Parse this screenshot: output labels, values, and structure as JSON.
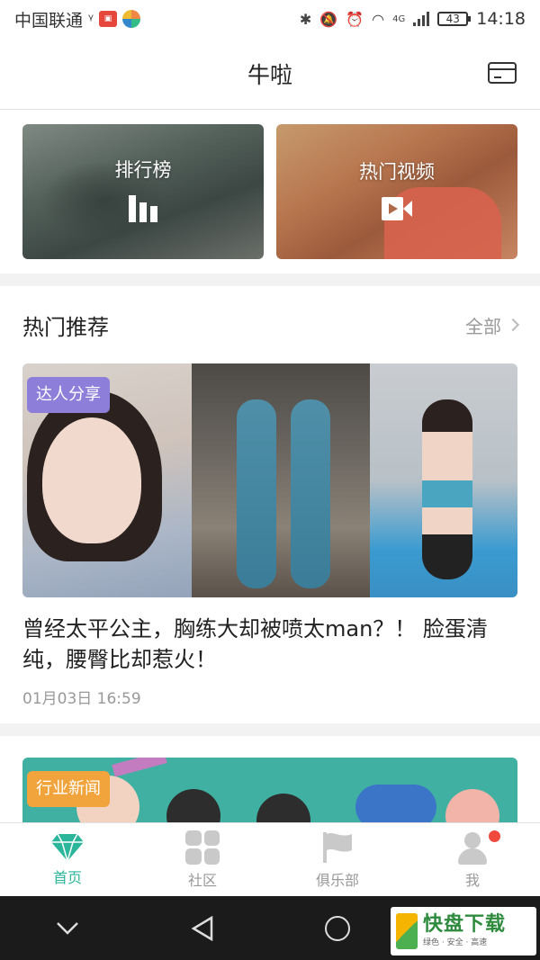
{
  "status_bar": {
    "carrier": "中国联通",
    "network": "4G",
    "battery": "43",
    "time": "14:18"
  },
  "header": {
    "title": "牛啦",
    "right_icon": "card-icon"
  },
  "top_cards": [
    {
      "label": "排行榜",
      "icon": "bar-chart-icon"
    },
    {
      "label": "热门视频",
      "icon": "video-camera-icon"
    }
  ],
  "section": {
    "title": "热门推荐",
    "more": "全部"
  },
  "articles": [
    {
      "tag": "达人分享",
      "tag_color": "#8c7ed9",
      "title": "曾经太平公主，胸练大却被喷太man？！ 脸蛋清纯，腰臀比却惹火！",
      "time": "01月03日 16:59"
    },
    {
      "tag": "行业新闻",
      "tag_color": "#f2a43c"
    }
  ],
  "bottom_nav": [
    {
      "label": "首页",
      "icon": "diamond-icon",
      "active": true
    },
    {
      "label": "社区",
      "icon": "grid-icon",
      "active": false
    },
    {
      "label": "俱乐部",
      "icon": "flag-icon",
      "active": false
    },
    {
      "label": "我",
      "icon": "user-icon",
      "active": false,
      "badge": true
    }
  ],
  "colors": {
    "accent": "#2bb59a",
    "badge": "#f04a3e",
    "inactive": "#999999"
  },
  "watermark": {
    "main": "快盘下载",
    "sub": "绿色 · 安全 · 高速"
  }
}
